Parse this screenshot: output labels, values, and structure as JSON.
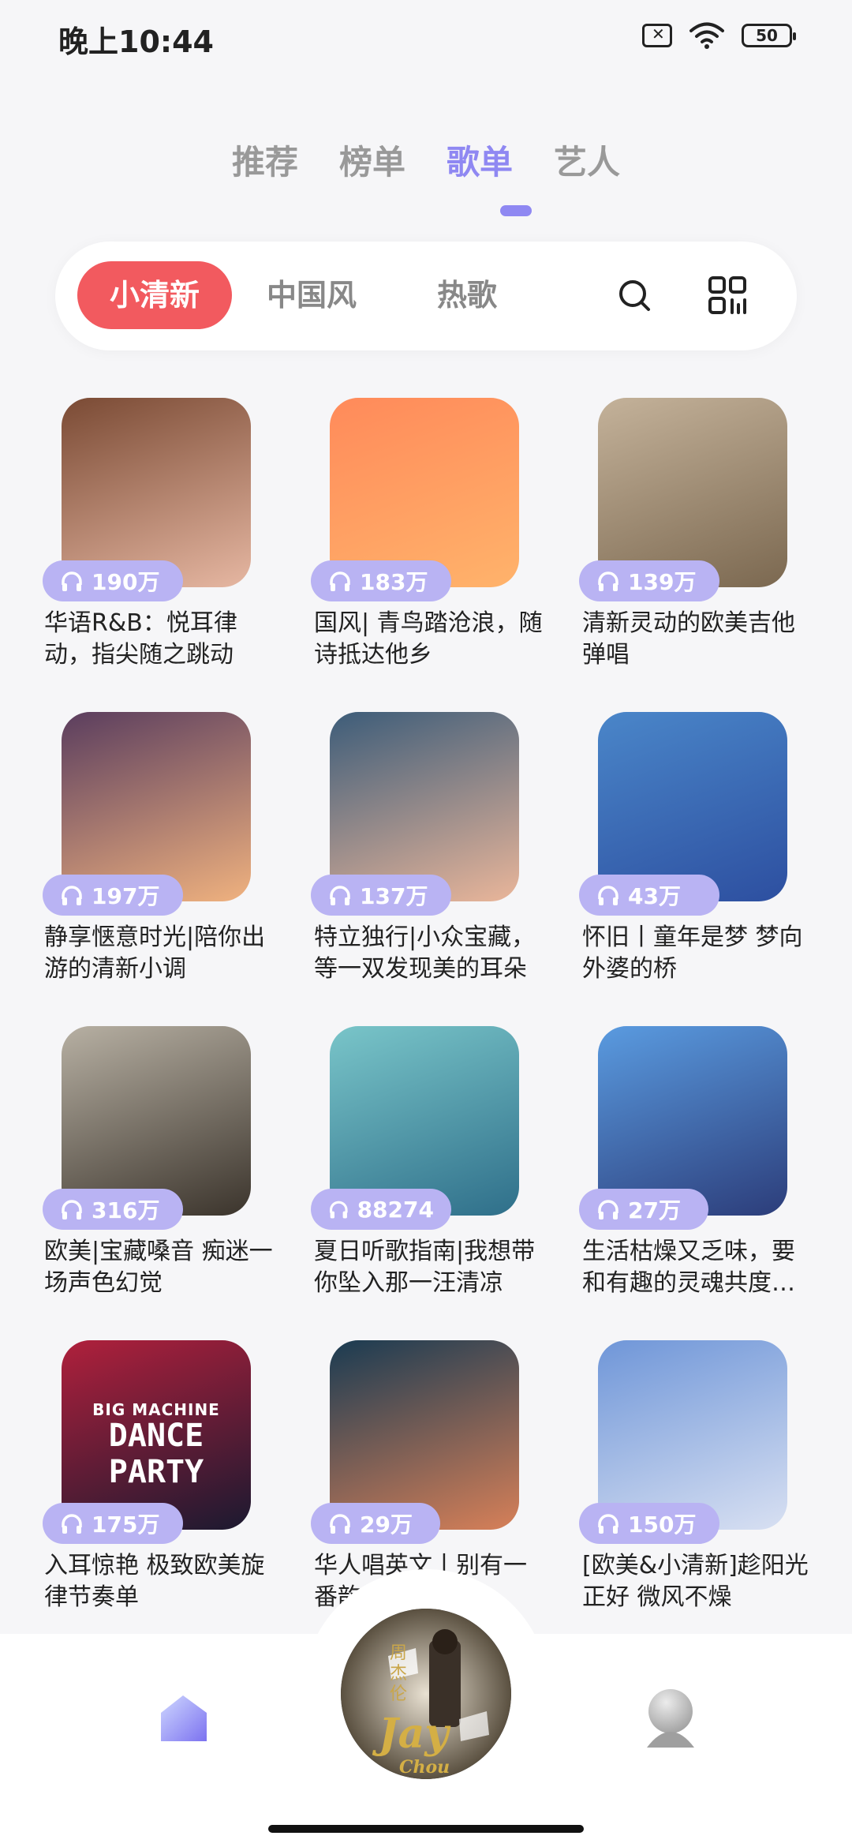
{
  "status_bar": {
    "time": "晚上10:44",
    "battery": "50"
  },
  "top_tabs": [
    {
      "label": "推荐",
      "active": false
    },
    {
      "label": "榜单",
      "active": false
    },
    {
      "label": "歌单",
      "active": true
    },
    {
      "label": "艺人",
      "active": false
    }
  ],
  "filters": [
    {
      "label": "小清新",
      "active": true
    },
    {
      "label": "中国风",
      "active": false
    },
    {
      "label": "热歌",
      "active": false
    }
  ],
  "toolbar_icons": [
    "search-icon",
    "grid-icon"
  ],
  "playlists": [
    {
      "plays": "190万",
      "title": "华语R&B：悦耳律动，指尖随之跳动",
      "cover_colors": [
        "#7a4a34",
        "#e6b7a2"
      ]
    },
    {
      "plays": "183万",
      "title": "国风| 青鸟踏沧浪，随诗抵达他乡",
      "cover_colors": [
        "#ff8a5a",
        "#ffb36b"
      ]
    },
    {
      "plays": "139万",
      "title": "清新灵动的欧美吉他弹唱",
      "cover_colors": [
        "#c4b29a",
        "#7b6850"
      ]
    },
    {
      "plays": "197万",
      "title": "静享惬意时光|陪你出游的清新小调",
      "cover_colors": [
        "#5a3d5e",
        "#f0b27f"
      ]
    },
    {
      "plays": "137万",
      "title": "特立独行|小众宝藏，等一双发现美的耳朵",
      "cover_colors": [
        "#3c5c79",
        "#eab69a"
      ]
    },
    {
      "plays": "43万",
      "title": "怀旧丨童年是梦 梦向外婆的桥",
      "cover_colors": [
        "#4a86c9",
        "#2d4fa0"
      ]
    },
    {
      "plays": "316万",
      "title": "欧美|宝藏嗓音 痴迷一场声色幻觉",
      "cover_colors": [
        "#b7b0a3",
        "#3b342c"
      ]
    },
    {
      "plays": "88274",
      "title": "夏日听歌指南|我想带你坠入那一汪清凉",
      "cover_colors": [
        "#79c5c9",
        "#2f6f8a"
      ]
    },
    {
      "plays": "27万",
      "title": "生活枯燥又乏味，要和有趣的灵魂共度…",
      "cover_colors": [
        "#5a9be0",
        "#2c3d7a"
      ]
    },
    {
      "plays": "175万",
      "title": "入耳惊艳 极致欧美旋律节奏单",
      "cover_colors": [
        "#b0203c",
        "#1b1930"
      ],
      "cover_text": [
        "BIG MACHINE",
        "DANCE PARTY"
      ]
    },
    {
      "plays": "29万",
      "title": "华人唱英文丨别有一番韵味",
      "cover_colors": [
        "#1a3b52",
        "#d78058"
      ]
    },
    {
      "plays": "150万",
      "title": "[欧美&小清新]趁阳光正好 微风不燥",
      "cover_colors": [
        "#6f96d8",
        "#d8e0f2"
      ]
    }
  ],
  "now_playing": {
    "cover_text": "Jay",
    "cover_sub": "Chou",
    "cover_vertical": "周杰伦"
  },
  "bottom_nav": [
    "home-icon",
    "now-playing-disc",
    "profile-icon"
  ],
  "colors": {
    "accent": "#8f88f2",
    "chip_active": "#f25a5f",
    "badge": "#b9b3f3"
  }
}
